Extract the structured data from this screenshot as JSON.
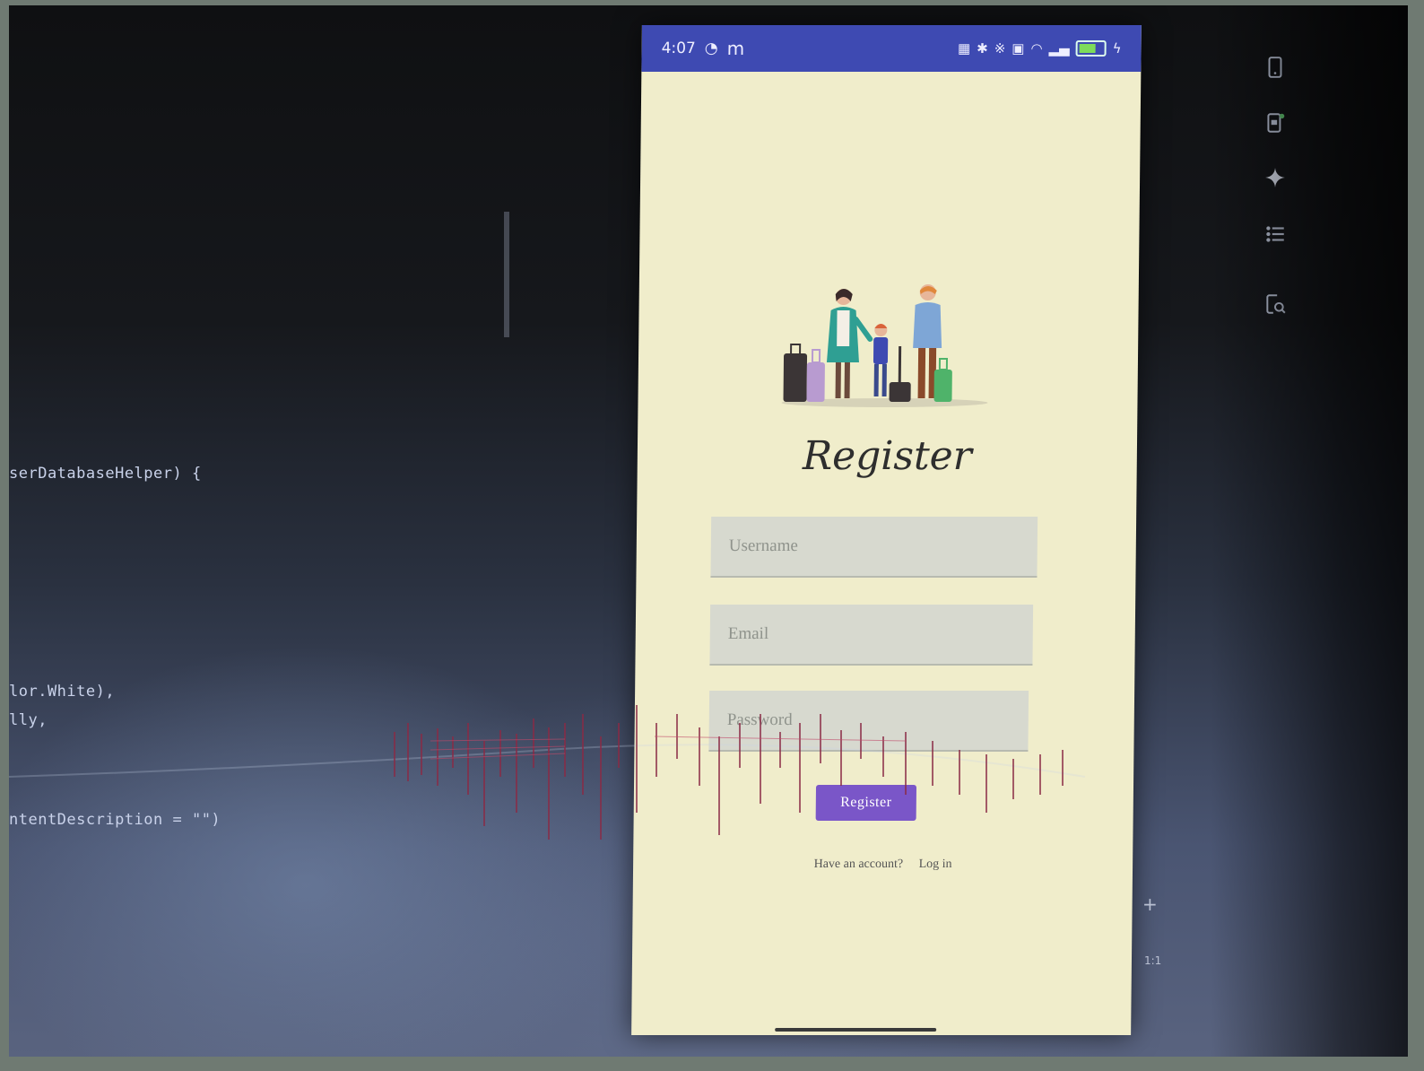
{
  "editor": {
    "code_lines": [
      "serDatabaseHelper) {",
      "lor.White),",
      "lly,",
      "ntentDescription = \"\")"
    ]
  },
  "ide_toolbar": {
    "icons": [
      "device-manager-icon",
      "running-devices-icon",
      "gemini-icon",
      "layout-inspector-icon",
      "app-inspection-icon"
    ]
  },
  "statusbar": {
    "time": "4:07",
    "carrier_glyph": "m"
  },
  "register": {
    "title": "Register",
    "username_placeholder": "Username",
    "email_placeholder": "Email",
    "password_placeholder": "Password",
    "button_label": "Register",
    "have_account_text": "Have an account?",
    "login_link": "Log in"
  },
  "colors": {
    "statusbar": "#3e4ab2",
    "screen_bg": "#f0edcb",
    "field_bg": "#d7d9cf",
    "button": "#7a56c8"
  }
}
